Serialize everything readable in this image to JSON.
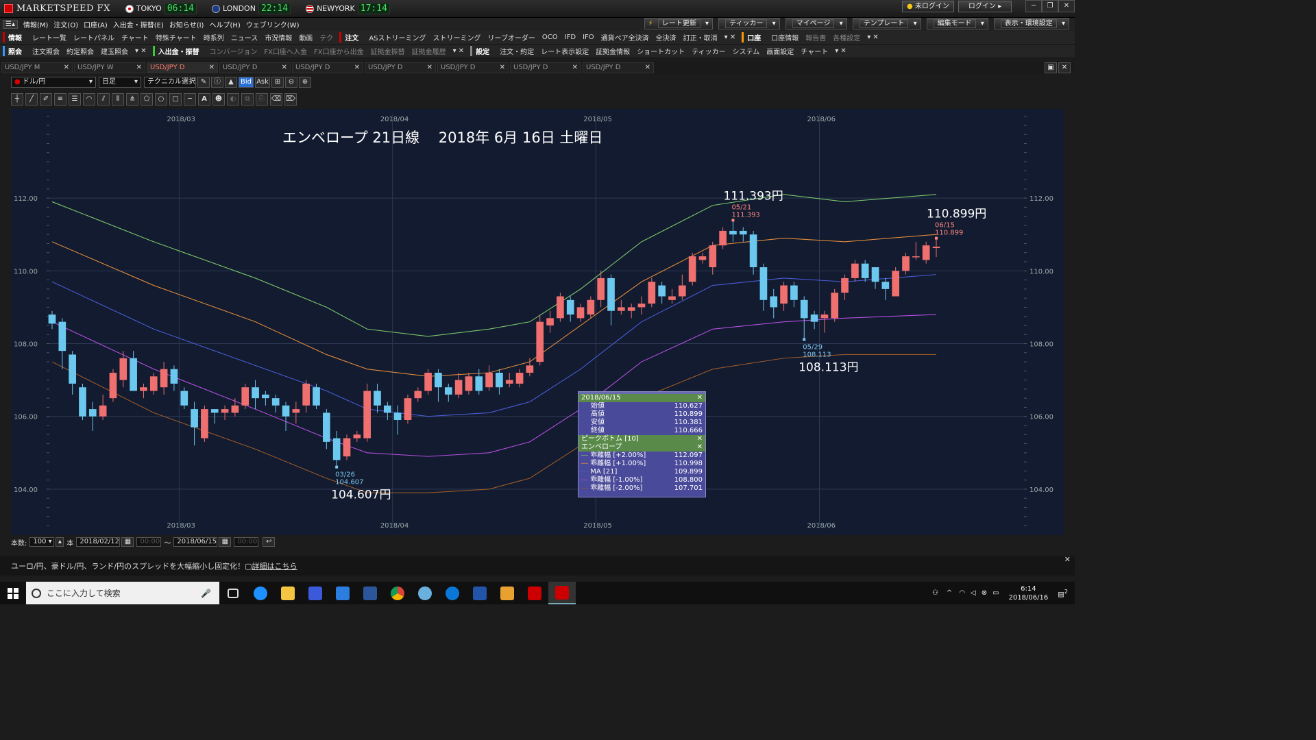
{
  "app": {
    "title": "MARKETSPEED FX"
  },
  "clocks": [
    {
      "city": "TOKYO",
      "time": "06:14"
    },
    {
      "city": "LONDON",
      "time": "22:14"
    },
    {
      "city": "NEWYORK",
      "time": "17:14"
    }
  ],
  "login": {
    "status": "未ログイン",
    "button": "ログイン"
  },
  "menu": [
    "情報(M)",
    "注文(O)",
    "口座(A)",
    "入出金・振替(E)",
    "お知らせ(I)",
    "ヘルプ(H)",
    "ウェブリンク(W)"
  ],
  "top_right_buttons": [
    "レート更新",
    "ティッカー",
    "マイページ",
    "テンプレート",
    "編集モード",
    "表示・環境設定"
  ],
  "toolbar1": {
    "group1": "情報",
    "items1": [
      "レート一覧",
      "レートパネル",
      "チャート",
      "特殊チャート",
      "時系列",
      "ニュース",
      "市況情報",
      "動画",
      "テク"
    ],
    "group2": "注文",
    "items2": [
      "ASストリーミング",
      "ストリーミング",
      "リーブオーダー",
      "OCO",
      "IFD",
      "IFO",
      "通貨ペア全決済",
      "全決済",
      "訂正・取消"
    ],
    "group3": "口座",
    "items3": [
      "口座情報",
      "報告書",
      "各種設定"
    ]
  },
  "toolbar2": {
    "group1": "照会",
    "items1": [
      "注文照会",
      "約定照会",
      "建玉照会"
    ],
    "group2": "入出金・振替",
    "items2": [
      "コンバージョン",
      "FX口座へ入金",
      "FX口座から出金",
      "証拠金振替",
      "証拠金履歴"
    ],
    "group3": "設定",
    "items3": [
      "注文・約定",
      "レート表示設定",
      "証拠金情報",
      "ショートカット",
      "ティッカー",
      "システム",
      "画面設定",
      "チャート"
    ]
  },
  "tabs": [
    "USD/JPY M",
    "USD/JPY W",
    "USD/JPY D",
    "USD/JPY D",
    "USD/JPY D",
    "USD/JPY D",
    "USD/JPY D",
    "USD/JPY D",
    "USD/JPY D"
  ],
  "active_tab": 2,
  "chart_tools": {
    "pair": "ドル/円",
    "period": "日足",
    "technical": "テクニカル選択",
    "bid": "Bid",
    "ask": "Ask"
  },
  "drawing_tools": [
    "crosshair-icon",
    "line-icon",
    "pencil-icon",
    "hlines-icon",
    "parallel-icon",
    "fan-icon",
    "channel-icon",
    "grid-icon",
    "pitchfork-icon",
    "pentagon-icon",
    "circle-icon",
    "rect-icon",
    "hline-icon",
    "text-icon",
    "icon-tool",
    "hide-icon",
    "copy-icon",
    "paste-icon",
    "eraser-icon",
    "erase-all-icon"
  ],
  "bottom": {
    "count_label": "本数:",
    "count": "100",
    "unit": "本",
    "from": "2018/02/12",
    "time_placeholder": "00:00",
    "tilde": "〜",
    "to": "2018/06/15"
  },
  "info": {
    "text": "ユーロ/円、豪ドル/円、ランド/円のスプレッドを大幅縮小し固定化！",
    "link": "詳細はこちら"
  },
  "taskbar": {
    "search_placeholder": "ここに入力して検索",
    "time": "6:14",
    "date": "2018/06/16",
    "notif": "2"
  },
  "popup": {
    "date": "2018/06/15",
    "ohlc": [
      {
        "label": "始値",
        "value": "110.627"
      },
      {
        "label": "高値",
        "value": "110.899"
      },
      {
        "label": "安値",
        "value": "110.381"
      },
      {
        "label": "終値",
        "value": "110.666"
      }
    ],
    "peak": "ピークボトム [10]",
    "envelope": "エンベロープ",
    "bands": [
      {
        "label": "乖離幅 [+2.00%]",
        "value": "112.097",
        "color": "#7cc66e"
      },
      {
        "label": "乖離幅 [+1.00%]",
        "value": "110.998",
        "color": "#e08a3c"
      },
      {
        "label": "MA [21]",
        "value": "109.899",
        "color": "#4a5cd6"
      },
      {
        "label": "乖離幅 [-1.00%]",
        "value": "108.800",
        "color": "#b44fe0"
      },
      {
        "label": "乖離幅 [-2.00%]",
        "value": "107.701",
        "color": "#9a5a2a"
      }
    ]
  },
  "chart_data": {
    "type": "candlestick",
    "title": "エンベロープ 21日線　 2018年 6月 16日 土曜日",
    "ylim": [
      103.0,
      114.3
    ],
    "yticks": [
      104,
      106,
      108,
      110,
      112
    ],
    "ytick_labels": [
      "104.00",
      "106.00",
      "108.00",
      "110.00",
      "112.00"
    ],
    "xticks": [
      {
        "label": "2018/03",
        "i": 13
      },
      {
        "label": "2018/04",
        "i": 34
      },
      {
        "label": "2018/05",
        "i": 54
      },
      {
        "label": "2018/06",
        "i": 76
      }
    ],
    "candles": [
      [
        108.8,
        108.55,
        108.4,
        108.9
      ],
      [
        108.6,
        107.8,
        107.3,
        108.7
      ],
      [
        107.7,
        106.9,
        106.6,
        107.8
      ],
      [
        106.8,
        106.0,
        105.9,
        106.9
      ],
      [
        106.2,
        106.0,
        105.6,
        106.4
      ],
      [
        106.0,
        106.3,
        105.9,
        106.6
      ],
      [
        106.5,
        107.2,
        106.4,
        107.3
      ],
      [
        107.0,
        107.6,
        106.8,
        107.8
      ],
      [
        107.6,
        106.7,
        106.7,
        107.8
      ],
      [
        106.7,
        106.8,
        106.5,
        106.9
      ],
      [
        106.7,
        107.1,
        106.6,
        107.2
      ],
      [
        106.8,
        107.3,
        106.6,
        107.5
      ],
      [
        107.3,
        106.9,
        106.7,
        107.4
      ],
      [
        106.7,
        106.3,
        106.2,
        106.8
      ],
      [
        106.2,
        105.7,
        105.2,
        106.4
      ],
      [
        105.4,
        106.2,
        105.3,
        106.3
      ],
      [
        106.2,
        106.1,
        105.8,
        106.2
      ],
      [
        106.1,
        106.2,
        105.9,
        106.3
      ],
      [
        106.1,
        106.3,
        106.0,
        106.5
      ],
      [
        106.3,
        106.8,
        106.2,
        106.9
      ],
      [
        106.8,
        106.5,
        106.2,
        107.0
      ],
      [
        106.6,
        106.5,
        106.3,
        106.7
      ],
      [
        106.5,
        106.3,
        106.1,
        106.6
      ],
      [
        106.3,
        106.0,
        105.6,
        106.4
      ],
      [
        106.1,
        106.2,
        105.8,
        106.4
      ],
      [
        106.3,
        106.9,
        106.1,
        107.0
      ],
      [
        106.8,
        106.3,
        106.2,
        106.9
      ],
      [
        106.1,
        105.3,
        105.1,
        106.2
      ],
      [
        105.4,
        104.8,
        104.607,
        105.6
      ],
      [
        104.9,
        105.4,
        104.8,
        105.5
      ],
      [
        105.4,
        105.5,
        105.3,
        105.6
      ],
      [
        105.4,
        106.7,
        105.3,
        106.9
      ],
      [
        106.7,
        106.3,
        106.1,
        106.9
      ],
      [
        106.3,
        106.1,
        105.9,
        106.4
      ],
      [
        106.1,
        105.9,
        105.5,
        106.3
      ],
      [
        105.9,
        106.5,
        105.8,
        106.6
      ],
      [
        106.5,
        106.7,
        106.4,
        106.8
      ],
      [
        106.7,
        107.2,
        106.6,
        107.3
      ],
      [
        107.2,
        106.8,
        106.4,
        107.3
      ],
      [
        106.8,
        106.6,
        106.4,
        106.9
      ],
      [
        106.6,
        107.0,
        106.5,
        107.2
      ],
      [
        106.7,
        107.1,
        106.6,
        107.2
      ],
      [
        107.1,
        106.7,
        106.6,
        107.3
      ],
      [
        106.8,
        107.2,
        106.7,
        107.4
      ],
      [
        107.2,
        106.8,
        106.6,
        107.3
      ],
      [
        106.9,
        107.0,
        106.8,
        107.2
      ],
      [
        106.9,
        107.2,
        106.8,
        107.3
      ],
      [
        107.2,
        107.4,
        107.1,
        107.6
      ],
      [
        107.5,
        108.6,
        107.4,
        108.8
      ],
      [
        108.5,
        108.7,
        108.3,
        108.9
      ],
      [
        108.7,
        109.3,
        108.6,
        109.4
      ],
      [
        109.2,
        108.8,
        108.6,
        109.3
      ],
      [
        108.7,
        109.0,
        108.6,
        109.1
      ],
      [
        108.8,
        109.2,
        108.7,
        109.3
      ],
      [
        109.2,
        109.8,
        109.0,
        110.0
      ],
      [
        109.8,
        108.9,
        108.5,
        109.9
      ],
      [
        108.9,
        109.0,
        108.8,
        109.2
      ],
      [
        108.9,
        109.0,
        108.7,
        109.1
      ],
      [
        109.0,
        109.1,
        108.8,
        109.3
      ],
      [
        109.1,
        109.7,
        109.0,
        109.8
      ],
      [
        109.6,
        109.3,
        109.1,
        109.7
      ],
      [
        109.2,
        109.3,
        109.1,
        109.5
      ],
      [
        109.3,
        109.6,
        109.2,
        109.9
      ],
      [
        109.7,
        110.4,
        109.6,
        110.5
      ],
      [
        110.3,
        110.4,
        110.2,
        110.5
      ],
      [
        110.1,
        110.7,
        109.9,
        110.8
      ],
      [
        110.7,
        111.1,
        110.6,
        111.2
      ],
      [
        111.1,
        111.0,
        110.8,
        111.393
      ],
      [
        111.1,
        111.0,
        110.8,
        111.2
      ],
      [
        111.0,
        110.1,
        109.9,
        111.1
      ],
      [
        110.1,
        109.2,
        108.9,
        110.2
      ],
      [
        109.3,
        109.0,
        108.7,
        109.5
      ],
      [
        109.1,
        109.6,
        108.9,
        109.7
      ],
      [
        109.6,
        109.2,
        109.0,
        109.7
      ],
      [
        109.2,
        108.7,
        108.113,
        109.3
      ],
      [
        108.8,
        108.6,
        108.4,
        108.9
      ],
      [
        108.7,
        108.8,
        108.3,
        108.9
      ],
      [
        108.7,
        109.4,
        108.6,
        109.5
      ],
      [
        109.4,
        109.8,
        109.2,
        109.9
      ],
      [
        109.8,
        110.2,
        109.7,
        110.3
      ],
      [
        110.2,
        109.8,
        109.7,
        110.3
      ],
      [
        110.1,
        109.7,
        109.5,
        110.1
      ],
      [
        109.7,
        109.5,
        109.2,
        109.8
      ],
      [
        109.3,
        110.0,
        109.3,
        110.1
      ],
      [
        110.0,
        110.4,
        109.9,
        110.5
      ],
      [
        110.4,
        110.4,
        110.3,
        110.8
      ],
      [
        110.3,
        110.7,
        110.2,
        110.8
      ],
      [
        110.627,
        110.666,
        110.381,
        110.899
      ]
    ],
    "bands": {
      "plus2": {
        "name": "乖離幅 [+2.00%]",
        "color": "#7cc66e",
        "values": [
          [
            0,
            111.9
          ],
          [
            10,
            110.8
          ],
          [
            20,
            109.8
          ],
          [
            27,
            109.0
          ],
          [
            31,
            108.4
          ],
          [
            37,
            108.2
          ],
          [
            43,
            108.4
          ],
          [
            47,
            108.6
          ],
          [
            52,
            109.5
          ],
          [
            58,
            110.8
          ],
          [
            65,
            111.8
          ],
          [
            72,
            112.1
          ],
          [
            78,
            111.9
          ],
          [
            87,
            112.1
          ]
        ]
      },
      "plus1": {
        "name": "乖離幅 [+1.00%]",
        "color": "#e08a3c",
        "values": [
          [
            0,
            110.8
          ],
          [
            10,
            109.6
          ],
          [
            20,
            108.6
          ],
          [
            27,
            107.7
          ],
          [
            31,
            107.3
          ],
          [
            37,
            107.1
          ],
          [
            43,
            107.2
          ],
          [
            47,
            107.5
          ],
          [
            52,
            108.5
          ],
          [
            58,
            109.7
          ],
          [
            65,
            110.7
          ],
          [
            72,
            110.9
          ],
          [
            78,
            110.8
          ],
          [
            87,
            111.0
          ]
        ]
      },
      "ma": {
        "name": "MA [21]",
        "color": "#4a5cd6",
        "values": [
          [
            0,
            109.7
          ],
          [
            10,
            108.4
          ],
          [
            20,
            107.4
          ],
          [
            27,
            106.7
          ],
          [
            31,
            106.2
          ],
          [
            37,
            106.0
          ],
          [
            43,
            106.1
          ],
          [
            47,
            106.4
          ],
          [
            52,
            107.3
          ],
          [
            58,
            108.6
          ],
          [
            65,
            109.6
          ],
          [
            72,
            109.8
          ],
          [
            78,
            109.7
          ],
          [
            87,
            109.9
          ]
        ]
      },
      "minus1": {
        "name": "乖離幅 [-1.00%]",
        "color": "#b44fe0",
        "values": [
          [
            0,
            108.6
          ],
          [
            10,
            107.3
          ],
          [
            20,
            106.2
          ],
          [
            27,
            105.4
          ],
          [
            31,
            105.0
          ],
          [
            37,
            104.9
          ],
          [
            43,
            105.0
          ],
          [
            47,
            105.3
          ],
          [
            52,
            106.2
          ],
          [
            58,
            107.5
          ],
          [
            65,
            108.4
          ],
          [
            72,
            108.6
          ],
          [
            78,
            108.7
          ],
          [
            87,
            108.8
          ]
        ]
      },
      "minus2": {
        "name": "乖離幅 [-2.00%]",
        "color": "#9a5a2a",
        "values": [
          [
            0,
            107.5
          ],
          [
            10,
            106.1
          ],
          [
            20,
            105.1
          ],
          [
            27,
            104.3
          ],
          [
            31,
            103.9
          ],
          [
            37,
            103.9
          ],
          [
            43,
            104.0
          ],
          [
            47,
            104.3
          ],
          [
            52,
            105.2
          ],
          [
            58,
            106.5
          ],
          [
            65,
            107.3
          ],
          [
            72,
            107.6
          ],
          [
            78,
            107.7
          ],
          [
            87,
            107.7
          ]
        ]
      }
    },
    "annotations": [
      {
        "i": 67,
        "price": 111.393,
        "date": "05/21",
        "value": "111.393",
        "big": "111.393円",
        "pos": "above"
      },
      {
        "i": 87,
        "price": 110.899,
        "date": "06/15",
        "value": "110.899",
        "big": "110.899円",
        "pos": "above"
      },
      {
        "i": 74,
        "price": 108.113,
        "date": "05/29",
        "value": "108.113",
        "big": "108.113円",
        "pos": "below"
      },
      {
        "i": 28,
        "price": 104.607,
        "date": "03/26",
        "value": "104.607",
        "big": "104.607円",
        "pos": "below"
      }
    ]
  }
}
